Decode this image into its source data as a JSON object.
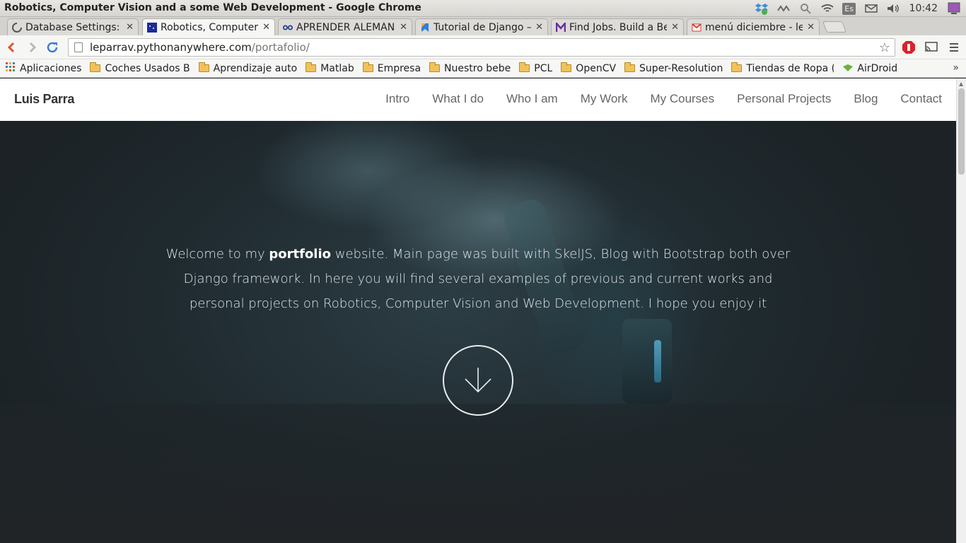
{
  "os": {
    "window_title": "Robotics, Computer Vision and a some Web Development - Google Chrome",
    "keyboard_layout": "Es",
    "clock": "10:42"
  },
  "tabs": [
    {
      "label": "Database Settings: P",
      "icon": "loading-icon",
      "active": false
    },
    {
      "label": "Robotics, Computer",
      "icon": "site-favicon",
      "active": true
    },
    {
      "label": "APRENDER ALEMÁN",
      "icon": "glasses-icon",
      "active": false
    },
    {
      "label": "Tutorial de Django –",
      "icon": "bookmark-blue-icon",
      "active": false
    },
    {
      "label": "Find Jobs. Build a Be",
      "icon": "m-logo-icon",
      "active": false
    },
    {
      "label": "menú diciembre - lep",
      "icon": "gmail-icon",
      "active": false
    }
  ],
  "toolbar": {
    "url_host": "leparrav.pythonanywhere.com",
    "url_path": "/portafolio/"
  },
  "bookmarks": [
    {
      "label": "Aplicaciones",
      "type": "apps"
    },
    {
      "label": "Coches Usados B",
      "type": "folder"
    },
    {
      "label": "Aprendizaje auto",
      "type": "folder"
    },
    {
      "label": "Matlab",
      "type": "folder"
    },
    {
      "label": "Empresa",
      "type": "folder"
    },
    {
      "label": "Nuestro bebe",
      "type": "folder"
    },
    {
      "label": "PCL",
      "type": "folder"
    },
    {
      "label": "OpenCV",
      "type": "folder"
    },
    {
      "label": "Super-Resolution",
      "type": "folder"
    },
    {
      "label": "Tiendas de Ropa (",
      "type": "folder"
    },
    {
      "label": "AirDroid",
      "type": "link"
    }
  ],
  "bookmarks_more": "»",
  "site": {
    "brand": "Luis Parra",
    "nav": [
      "Intro",
      "What I do",
      "Who I am",
      "My Work",
      "My Courses",
      "Personal Projects",
      "Blog",
      "Contact"
    ],
    "intro_before": "Welcome to my ",
    "intro_bold": "portfolio",
    "intro_after": " website. Main page was built with SkelJS, Blog with Bootstrap both over Django framework. In here you will find several examples of previous and current works and personal projects on Robotics, Computer Vision and Web Development. I hope you enjoy it"
  }
}
